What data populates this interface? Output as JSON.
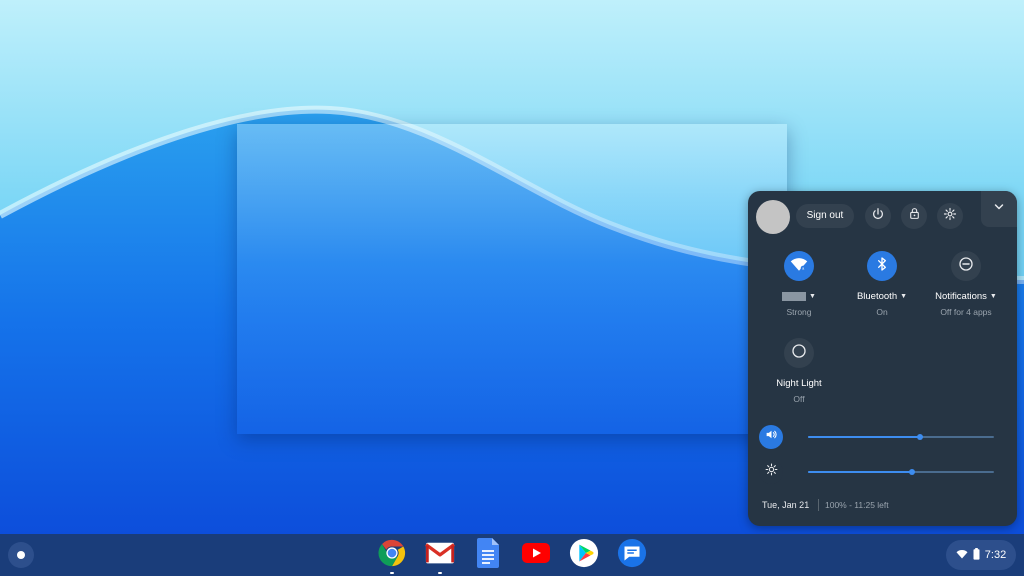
{
  "quick_settings": {
    "signout_label": "Sign out",
    "icons": [
      "power-icon",
      "lock-icon",
      "settings-icon",
      "chevron-down-icon"
    ],
    "features": [
      {
        "name": "wifi",
        "label": "",
        "status": "Strong",
        "on": true,
        "icon": "wifi-icon"
      },
      {
        "name": "bluetooth",
        "label": "Bluetooth",
        "status": "On",
        "on": true,
        "icon": "bluetooth-icon"
      },
      {
        "name": "notifications",
        "label": "Notifications",
        "status": "Off for 4 apps",
        "on": false,
        "icon": "do-not-disturb-icon"
      },
      {
        "name": "night-light",
        "label": "Night Light",
        "status": "Off",
        "on": false,
        "icon": "night-light-icon"
      }
    ],
    "volume_level": 0.6,
    "brightness_level": 0.56,
    "date": "Tue, Jan 21",
    "battery": "100% - 11:25 left"
  },
  "shelf": {
    "apps": [
      {
        "name": "chrome",
        "icon": "chrome-icon",
        "running": true
      },
      {
        "name": "gmail",
        "icon": "gmail-icon",
        "running": true
      },
      {
        "name": "docs",
        "icon": "docs-icon",
        "running": false
      },
      {
        "name": "youtube",
        "icon": "youtube-icon",
        "running": false
      },
      {
        "name": "play-store",
        "icon": "play-store-icon",
        "running": false
      },
      {
        "name": "messages",
        "icon": "messages-icon",
        "running": false
      }
    ],
    "time": "7:32"
  },
  "colors": {
    "accent": "#2a7ae2",
    "panel": "#263544",
    "shelf": "#1a3d7a"
  }
}
